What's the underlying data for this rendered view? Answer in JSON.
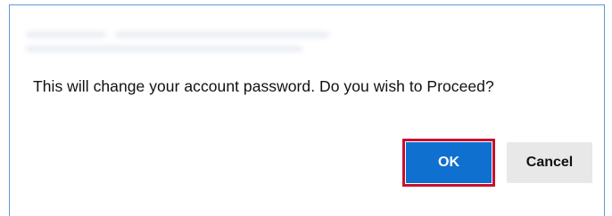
{
  "dialog": {
    "message": "This will change your account password. Do you wish to Proceed?",
    "ok_label": "OK",
    "cancel_label": "Cancel"
  },
  "colors": {
    "border": "#5b9bd5",
    "ok_background": "#0f70d0",
    "ok_highlight": "#c8102e",
    "cancel_background": "#e8e8e8"
  }
}
